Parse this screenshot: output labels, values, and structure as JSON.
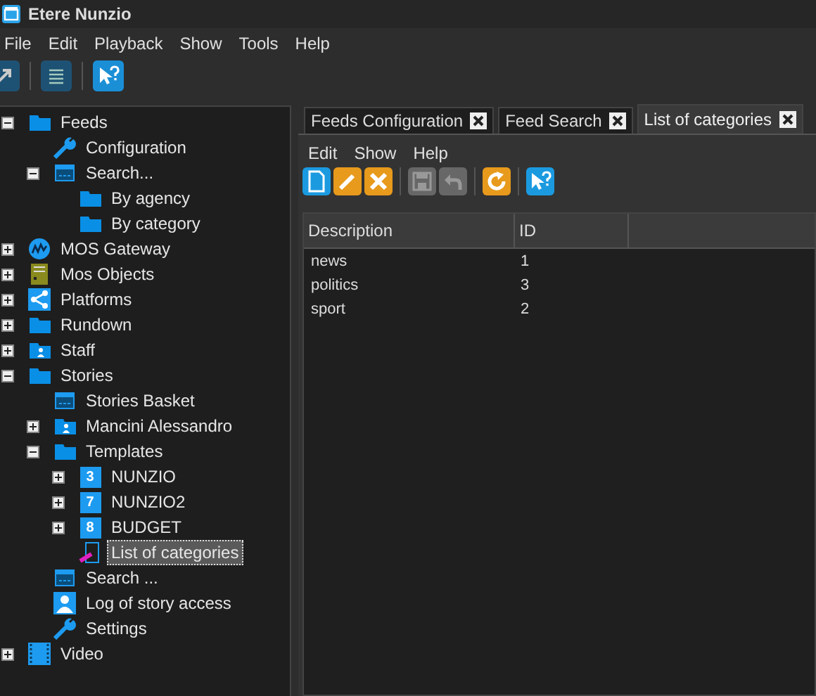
{
  "window": {
    "title": "Etere Nunzio"
  },
  "menu": [
    "File",
    "Edit",
    "Playback",
    "Show",
    "Tools",
    "Help"
  ],
  "toolbar": [
    {
      "kind": "link",
      "disabled": true
    },
    {
      "kind": "list",
      "disabled": true
    },
    {
      "kind": "help",
      "disabled": false
    }
  ],
  "tree": [
    {
      "label": "Feeds",
      "kind": "folder",
      "expanded": true,
      "children": [
        {
          "label": "Configuration",
          "kind": "wrench"
        },
        {
          "label": "Search...",
          "kind": "window",
          "expanded": true,
          "children": [
            {
              "label": "By agency",
              "kind": "folder"
            },
            {
              "label": "By category",
              "kind": "folder"
            }
          ]
        }
      ]
    },
    {
      "label": "MOS Gateway",
      "kind": "mos",
      "expanded": false
    },
    {
      "label": "Mos Objects",
      "kind": "server",
      "expanded": false
    },
    {
      "label": "Platforms",
      "kind": "share",
      "expanded": false
    },
    {
      "label": "Rundown",
      "kind": "folder",
      "expanded": false
    },
    {
      "label": "Staff",
      "kind": "userfolder",
      "expanded": false
    },
    {
      "label": "Stories",
      "kind": "folder",
      "expanded": true,
      "children": [
        {
          "label": "Stories Basket",
          "kind": "window"
        },
        {
          "label": "Mancini Alessandro",
          "kind": "userfolder",
          "expanded": false
        },
        {
          "label": "Templates",
          "kind": "folder",
          "expanded": true,
          "children": [
            {
              "label": "NUNZIO",
              "kind": "badge",
              "badge": "3",
              "expanded": false
            },
            {
              "label": "NUNZIO2",
              "kind": "badge",
              "badge": "7",
              "expanded": false
            },
            {
              "label": "BUDGET",
              "kind": "badge",
              "badge": "8",
              "expanded": false
            },
            {
              "label": "List of categories",
              "kind": "document",
              "selected": true
            }
          ]
        },
        {
          "label": "Search ...",
          "kind": "window"
        },
        {
          "label": "Log of story access",
          "kind": "person"
        },
        {
          "label": "Settings",
          "kind": "wrench"
        }
      ]
    },
    {
      "label": "Video",
      "kind": "film",
      "expanded": false
    }
  ],
  "tabs": [
    {
      "label": "Feeds Configuration",
      "selected": false
    },
    {
      "label": "Feed Search",
      "selected": false
    },
    {
      "label": "List of categories",
      "selected": true
    }
  ],
  "panel_menu": [
    "Edit",
    "Show",
    "Help"
  ],
  "panel_toolbar": [
    {
      "kind": "new",
      "disabled": false
    },
    {
      "kind": "edit",
      "disabled": false
    },
    {
      "kind": "delete",
      "disabled": false
    },
    {
      "kind": "save",
      "disabled": true
    },
    {
      "kind": "undo",
      "disabled": true
    },
    {
      "kind": "refresh",
      "disabled": false
    },
    {
      "kind": "help",
      "disabled": false
    }
  ],
  "table": {
    "columns": [
      "Description",
      "ID"
    ],
    "rows": [
      [
        "news",
        "1"
      ],
      [
        "politics",
        "3"
      ],
      [
        "sport",
        "2"
      ]
    ]
  }
}
